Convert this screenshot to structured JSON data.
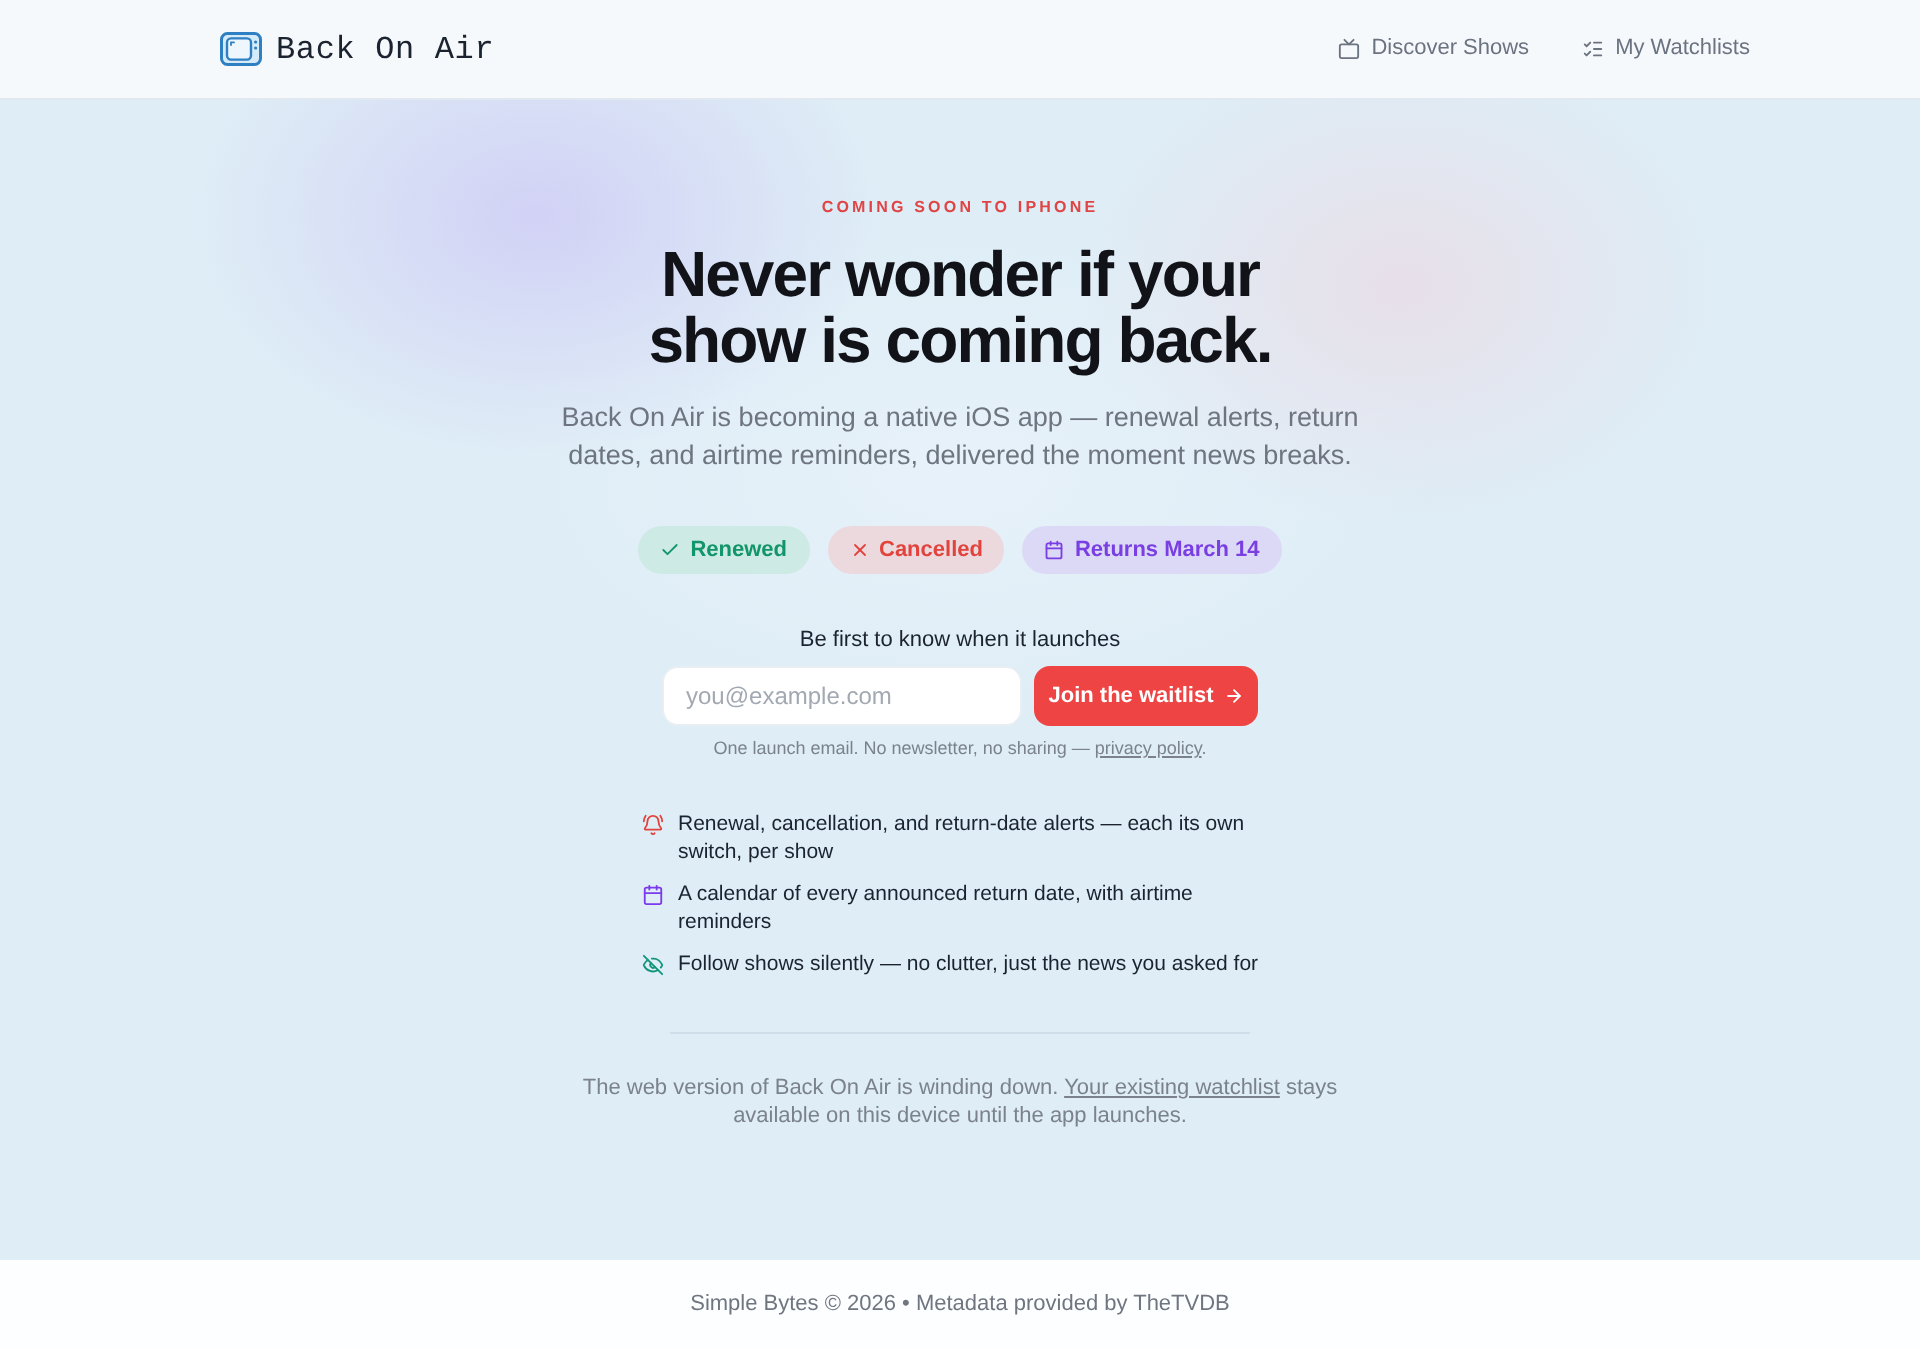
{
  "header": {
    "logo_text": "Back On Air",
    "nav": [
      {
        "kind": "tv",
        "label": "Discover Shows"
      },
      {
        "kind": "checklist",
        "label": "My Watchlists"
      }
    ]
  },
  "hero": {
    "eyebrow": "COMING SOON TO IPHONE",
    "title": "Never wonder if your show is coming back.",
    "subtitle": "Back On Air is becoming a native iOS app — renewal alerts, return dates, and airtime reminders, delivered the moment news breaks."
  },
  "status_chips": [
    {
      "kind": "renewed",
      "label": "Renewed"
    },
    {
      "kind": "cancelled",
      "label": "Cancelled"
    },
    {
      "kind": "returns",
      "label": "Returns March 14"
    }
  ],
  "waitlist": {
    "label": "Be first to know when it launches",
    "placeholder": "you@example.com",
    "button": "Join the waitlist",
    "note": "One launch email. No newsletter, no sharing —",
    "note_link": "privacy policy",
    "note_end": "."
  },
  "features": [
    {
      "kind": "alerts",
      "text": "Renewal, cancellation, and return-date alerts — each its own switch, per show"
    },
    {
      "kind": "calendar",
      "text": "A calendar of every announced return date, with airtime reminders"
    },
    {
      "kind": "silent",
      "text": "Follow shows silently — no clutter, just the news you asked for"
    }
  ],
  "notice": {
    "text": "The web version of Back On Air is winding down.",
    "link": "Your existing watchlist",
    "text_end": "stays available on this device until the app launches."
  },
  "footer": {
    "text": "Simple Bytes © 2026 • Metadata provided by TheTVDB"
  }
}
